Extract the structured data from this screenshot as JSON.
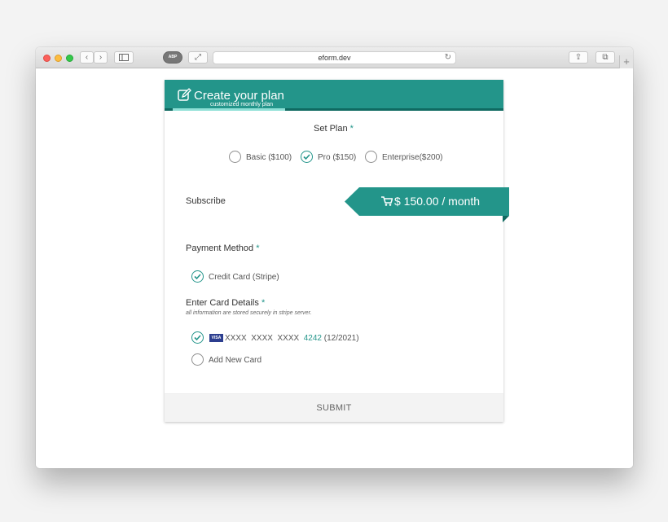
{
  "browser": {
    "url": "eform.dev",
    "addon_label": "ABP"
  },
  "header": {
    "title": "Create your plan",
    "subtitle": "customized monthly plan"
  },
  "plan": {
    "label": "Set Plan",
    "required": "*",
    "options": [
      {
        "label": "Basic ($100)",
        "checked": false
      },
      {
        "label": "Pro ($150)",
        "checked": true
      },
      {
        "label": "Enterprise($200)",
        "checked": false
      }
    ]
  },
  "subscribe": {
    "label": "Subscribe",
    "price": "$ 150.00 / month"
  },
  "payment": {
    "label": "Payment Method",
    "required": "*",
    "option": "Credit Card (Stripe)"
  },
  "card_details": {
    "label": "Enter Card Details",
    "required": "*",
    "note": "all information are stored securely in stripe server.",
    "saved_card": {
      "brand": "VISA",
      "masked": "XXXX  XXXX  XXXX",
      "last4": "4242",
      "expiry": "(12/2021)"
    },
    "add_new": "Add New Card"
  },
  "submit_label": "SUBMIT",
  "colors": {
    "accent": "#23958a",
    "accent_dark": "#0f6a61"
  }
}
